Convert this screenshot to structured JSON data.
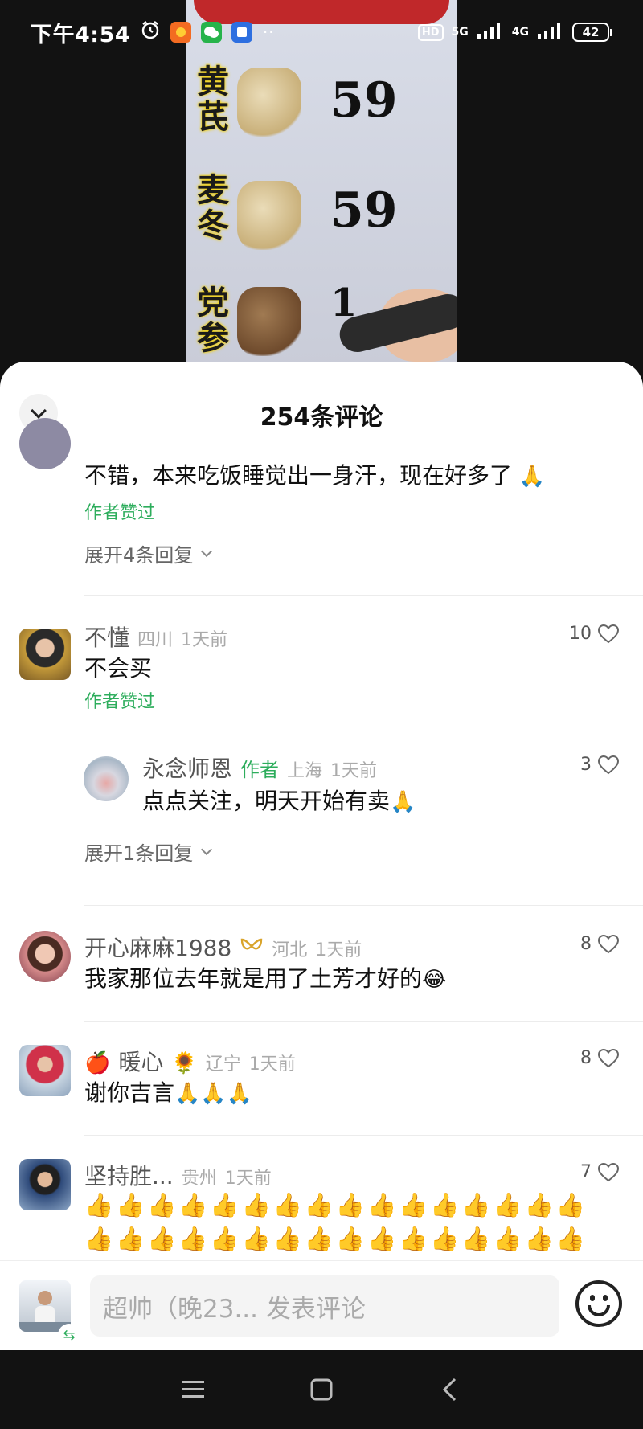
{
  "status_bar": {
    "time": "下午4:54",
    "network_5g": "5G",
    "network_4g": "4G",
    "hd_badge": "HD",
    "battery": "42"
  },
  "video": {
    "herbs": [
      {
        "name": "黄芪",
        "price": "59"
      },
      {
        "name": "麦冬",
        "price": "59"
      },
      {
        "name": "党参",
        "price": "1"
      }
    ]
  },
  "sheet": {
    "title": "254条评论"
  },
  "comments": [
    {
      "text": "不错，本来吃饭睡觉出一身汗，现在好多了",
      "text_emoji": "🙏",
      "author_liked": "作者赞过",
      "expand": "展开4条回复"
    },
    {
      "name": "不懂",
      "region": "四川",
      "time": "1天前",
      "likes": "10",
      "text": "不会买",
      "author_liked": "作者赞过",
      "reply": {
        "name": "永念师恩",
        "author_tag": "作者",
        "region": "上海",
        "time": "1天前",
        "likes": "3",
        "text": "点点关注，明天开始有卖",
        "text_emoji": "🙏"
      },
      "expand": "展开1条回复"
    },
    {
      "name": "开心麻麻1988",
      "region": "河北",
      "time": "1天前",
      "likes": "8",
      "text": "我家那位去年就是用了土芳才好的",
      "text_emoji": "😂"
    },
    {
      "name_prefix_emoji": "🍎",
      "name": "暖心",
      "name_suffix_emoji": "🌻",
      "region": "辽宁",
      "time": "1天前",
      "likes": "8",
      "text": "谢你吉言",
      "text_emoji": "🙏🙏🙏"
    },
    {
      "name": "坚持胜...",
      "region": "贵州",
      "time": "1天前",
      "likes": "7",
      "text_emoji_line1": "👍👍👍👍👍👍👍👍👍👍👍👍👍👍👍👍",
      "text_emoji_line2": "👍👍👍👍👍👍👍👍👍👍👍👍👍👍👍👍"
    }
  ],
  "input_bar": {
    "placeholder": "超帅（晚23... 发表评论"
  },
  "colors": {
    "accent_green": "#2dad5c",
    "sheet_bg": "#ffffff",
    "dark_bg": "#121212"
  }
}
